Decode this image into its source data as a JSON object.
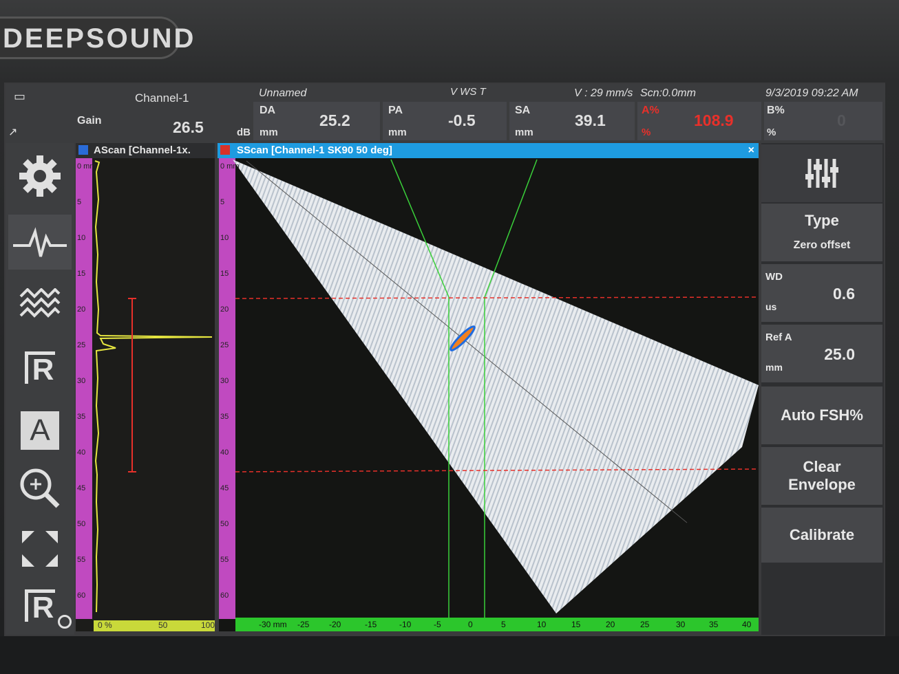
{
  "brand": "DEEPSOUND",
  "status": {
    "channel": "Channel-1",
    "file": "Unnamed",
    "flags": "V WS T",
    "velocity": "V : 29 mm/s",
    "scan": "Scn:0.0mm",
    "datetime": "9/3/2019 09:22 AM"
  },
  "gain": {
    "label": "Gain",
    "value": "26.5",
    "unit": "dB"
  },
  "readings": [
    {
      "label": "DA",
      "unit": "mm",
      "value": "25.2"
    },
    {
      "label": "PA",
      "unit": "mm",
      "value": "-0.5"
    },
    {
      "label": "SA",
      "unit": "mm",
      "value": "39.1"
    },
    {
      "label": "A%",
      "unit": "%",
      "value": "108.9"
    },
    {
      "label": "B%",
      "unit": "%",
      "value": "0"
    }
  ],
  "ascan": {
    "title": "AScan [Channel-1x."
  },
  "sscan": {
    "title": "SScan [Channel-1 SK90 50 deg]",
    "close": "×"
  },
  "depth_ticks": [
    "0 mm",
    "5",
    "10",
    "15",
    "20",
    "25",
    "30",
    "35",
    "40",
    "45",
    "50",
    "55",
    "60"
  ],
  "ascan_amp_ticks": [
    "0 %",
    "50",
    "100"
  ],
  "sscan_x_ticks": [
    "-30 mm",
    "-25",
    "-20",
    "-15",
    "-10",
    "-5",
    "0",
    "5",
    "10",
    "15",
    "20",
    "25",
    "30",
    "35",
    "40"
  ],
  "right_panel": {
    "type_label": "Type",
    "type_value": "Zero offset",
    "wd_label": "WD",
    "wd_unit": "us",
    "wd_value": "0.6",
    "refa_label": "Ref A",
    "refa_unit": "mm",
    "refa_value": "25.0",
    "auto_fsh": "Auto FSH%",
    "clear_envelope": "Clear Envelope",
    "calibrate": "Calibrate"
  },
  "sidebar_icons": [
    "settings-gear-icon",
    "waveform-icon",
    "scan-wave-icon",
    "reference-r-icon",
    "amplitude-a-icon",
    "zoom-icon",
    "fullscreen-icon",
    "reference-r-icon"
  ],
  "colors": {
    "accent_blue": "#1e9be0",
    "ruler_magenta": "#c04ac0",
    "alarm_red": "#e8302a",
    "gate_green": "#3ad03a",
    "ascan_yellow": "#e6e640"
  }
}
